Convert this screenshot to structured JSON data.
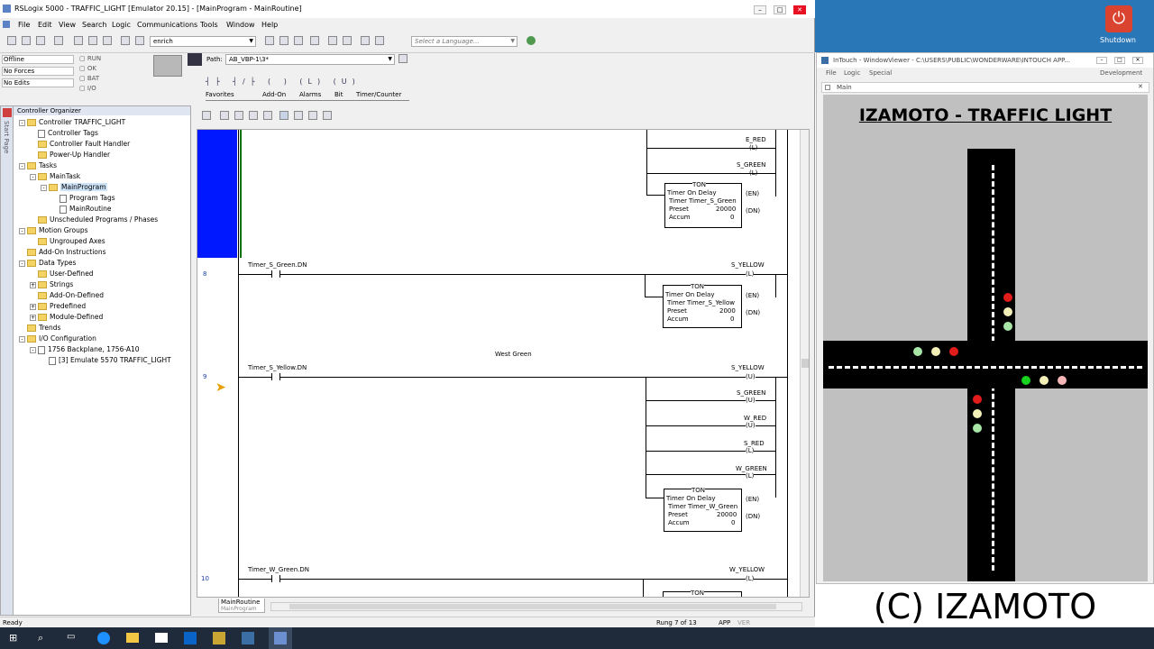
{
  "rslogix": {
    "title": "RSLogix 5000 - TRAFFIC_LIGHT [Emulator 20.15] - [MainProgram - MainRoutine]",
    "menu": [
      "File",
      "Edit",
      "View",
      "Search",
      "Logic",
      "Communications",
      "Tools",
      "Window",
      "Help"
    ],
    "search_combo": "enrich",
    "language_placeholder": "Select a Language...",
    "status": {
      "mode": "Offline",
      "forces": "No Forces",
      "edits": "No Edits",
      "run": "RUN",
      "ok": "OK",
      "bat": "BAT",
      "io": "I/O"
    },
    "path_label": "Path:",
    "path_value": "AB_VBP-1\\3*",
    "instr_tabs": [
      "Favorites",
      "Add-On",
      "Alarms",
      "Bit",
      "Timer/Counter"
    ],
    "organizer_title": "Controller Organizer",
    "start_page": "Start Page",
    "tree": [
      {
        "label": "Controller TRAFFIC_LIGHT",
        "indent": 1,
        "icon": "folder",
        "pm": "-"
      },
      {
        "label": "Controller Tags",
        "indent": 2,
        "icon": "doc"
      },
      {
        "label": "Controller Fault Handler",
        "indent": 2,
        "icon": "folder"
      },
      {
        "label": "Power-Up Handler",
        "indent": 2,
        "icon": "folder"
      },
      {
        "label": "Tasks",
        "indent": 1,
        "icon": "folder",
        "pm": "-"
      },
      {
        "label": "MainTask",
        "indent": 2,
        "icon": "folder",
        "pm": "-"
      },
      {
        "label": "MainProgram",
        "indent": 3,
        "icon": "folder",
        "pm": "-",
        "selected": true
      },
      {
        "label": "Program Tags",
        "indent": 4,
        "icon": "doc"
      },
      {
        "label": "MainRoutine",
        "indent": 4,
        "icon": "doc"
      },
      {
        "label": "Unscheduled Programs / Phases",
        "indent": 2,
        "icon": "folder"
      },
      {
        "label": "Motion Groups",
        "indent": 1,
        "icon": "folder",
        "pm": "-"
      },
      {
        "label": "Ungrouped Axes",
        "indent": 2,
        "icon": "folder"
      },
      {
        "label": "Add-On Instructions",
        "indent": 1,
        "icon": "folder"
      },
      {
        "label": "Data Types",
        "indent": 1,
        "icon": "folder",
        "pm": "-"
      },
      {
        "label": "User-Defined",
        "indent": 2,
        "icon": "folder"
      },
      {
        "label": "Strings",
        "indent": 2,
        "icon": "folder",
        "pm": "+"
      },
      {
        "label": "Add-On-Defined",
        "indent": 2,
        "icon": "folder"
      },
      {
        "label": "Predefined",
        "indent": 2,
        "icon": "folder",
        "pm": "+"
      },
      {
        "label": "Module-Defined",
        "indent": 2,
        "icon": "folder",
        "pm": "+"
      },
      {
        "label": "Trends",
        "indent": 1,
        "icon": "folder"
      },
      {
        "label": "I/O Configuration",
        "indent": 1,
        "icon": "folder",
        "pm": "-"
      },
      {
        "label": "1756 Backplane, 1756-A10",
        "indent": 2,
        "icon": "doc",
        "pm": "-"
      },
      {
        "label": "[3] Emulate 5570 TRAFFIC_LIGHT",
        "indent": 3,
        "icon": "doc"
      }
    ],
    "ladder": {
      "rung7_outputs": [
        "E_RED",
        "S_GREEN"
      ],
      "rung7_coil_types": [
        "(L)",
        "(L)"
      ],
      "timer_header": "TON",
      "timer_title": "Timer On Delay",
      "timer_label": "Timer",
      "preset_label": "Preset",
      "accum_label": "Accum",
      "en": "(EN)",
      "dn": "(DN)",
      "timer7": {
        "name": "Timer_S_Green",
        "preset": "20000",
        "accum": "0"
      },
      "rung8": {
        "num": "8",
        "contact": "Timer_S_Green.DN",
        "output": "S_YELLOW",
        "coil": "(L)",
        "timer": {
          "name": "Timer_S_Yellow",
          "preset": "2000",
          "accum": "0"
        }
      },
      "rung9": {
        "num": "9",
        "comment": "West Green",
        "contact": "Timer_S_Yellow.DN",
        "outputs": [
          {
            "name": "S_YELLOW",
            "coil": "(U)"
          },
          {
            "name": "S_GREEN",
            "coil": "(U)"
          },
          {
            "name": "W_RED",
            "coil": "(U)"
          },
          {
            "name": "S_RED",
            "coil": "(L)"
          },
          {
            "name": "W_GREEN",
            "coil": "(L)"
          }
        ],
        "timer": {
          "name": "Timer_W_Green",
          "preset": "20000",
          "accum": "0"
        }
      },
      "rung10": {
        "num": "10",
        "contact": "Timer_W_Green.DN",
        "output": "W_YELLOW",
        "coil": "(L)"
      }
    },
    "routine_tab": "MainRoutine",
    "routine_tab_sub": "MainProgram",
    "status_bar": {
      "left": "Ready",
      "rung": "Rung 7 of 13",
      "app": "APP",
      "ver": "VER"
    }
  },
  "intouch": {
    "title": "InTouch - WindowViewer - C:\\USERS\\PUBLIC\\WONDERWARE\\INTOUCH APP...",
    "menu": [
      "File",
      "Logic",
      "Special"
    ],
    "menu_right": "Development",
    "window_name": "Main",
    "heading": "IZAMOTO - TRAFFIC LIGHT"
  },
  "desktop": {
    "shutdown_label": "Shutdown"
  },
  "brand": "(C) IZAMOTO",
  "colors": {
    "blue_marker": "#0018ff",
    "red": "#e21b1b",
    "green_dim": "#a8e6a8",
    "yellow_dim": "#f3f0b8",
    "green_on": "#19d11f",
    "pink_dim": "#f7b7b7"
  }
}
